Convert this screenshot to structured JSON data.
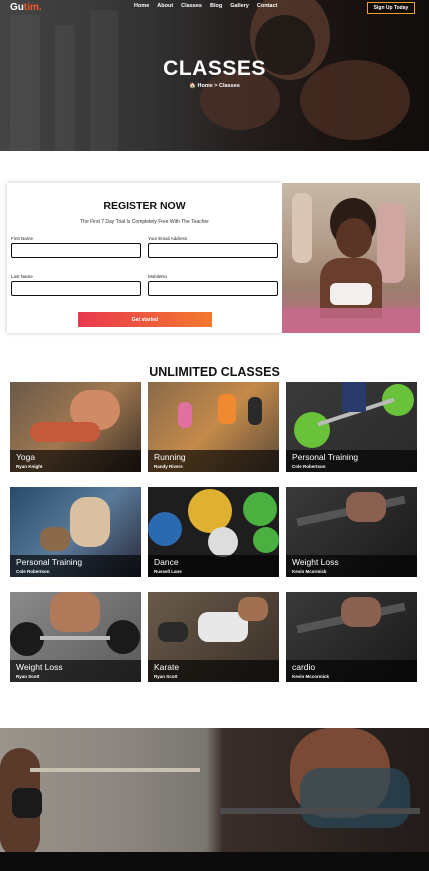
{
  "nav": {
    "logo_main": "Gu",
    "logo_accent": "tim.",
    "links": [
      "Home",
      "About",
      "Classes",
      "Blog",
      "Gallery",
      "Contact"
    ],
    "cta": "Sign Up Today"
  },
  "hero": {
    "title": "CLASSES",
    "breadcrumb": "🏠 Home > Classes"
  },
  "register": {
    "title": "REGISTER NOW",
    "subtitle": "The First 7 Day Trial Is Completely Free With The Teacher",
    "fields": {
      "first_name": "First Name",
      "email": "Your Email Address",
      "last_name": "Last Name",
      "mobile": "MobileNo"
    },
    "button": "Get started"
  },
  "classes": {
    "title": "UNLIMITED CLASSES",
    "items": [
      {
        "name": "Yoga",
        "trainer": "Ryan Knight"
      },
      {
        "name": "Running",
        "trainer": "Randy Rivers"
      },
      {
        "name": "Personal Training",
        "trainer": "Cole Robertson"
      },
      {
        "name": "Personal Training",
        "trainer": "Cole Robertson"
      },
      {
        "name": "Dance",
        "trainer": "Russell Lane"
      },
      {
        "name": "Weight Loss",
        "trainer": "Kevin Mcormick"
      },
      {
        "name": "Weight Loss",
        "trainer": "Ryan Scott"
      },
      {
        "name": "Karate",
        "trainer": "Ryan Scott"
      },
      {
        "name": "cardio",
        "trainer": "Kevin Mccormick"
      }
    ]
  },
  "colors": {
    "accent": "#f05a28",
    "button_start": "#e8394f",
    "button_end": "#f27a2e"
  }
}
